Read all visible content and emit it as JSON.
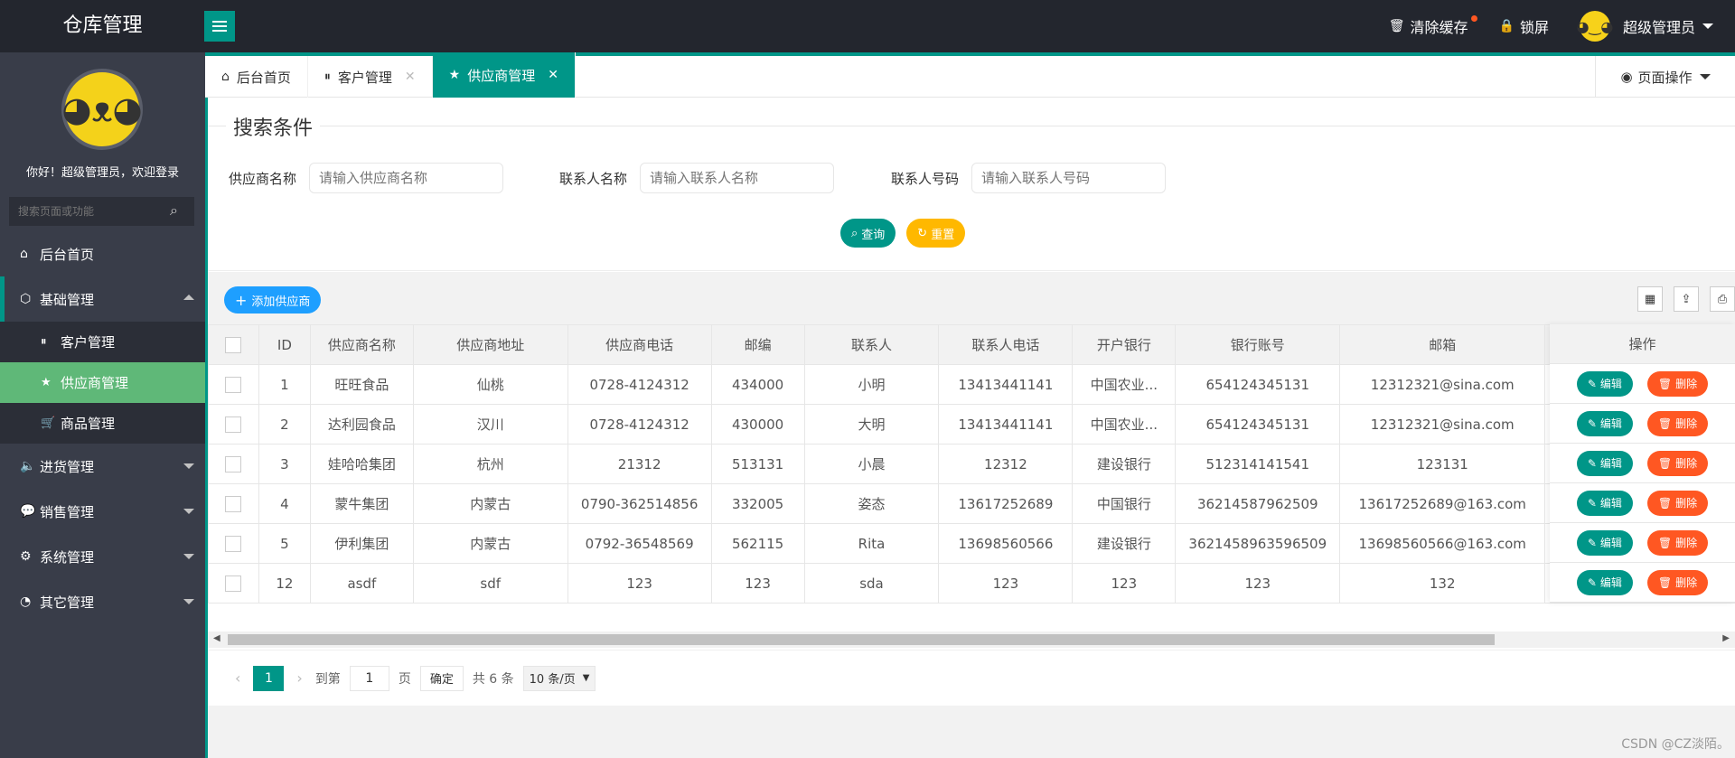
{
  "app": {
    "title": "仓库管理"
  },
  "header": {
    "clear_cache": "清除缓存",
    "lock": "锁屏",
    "user": "超级管理员"
  },
  "sidebar": {
    "welcome": "你好！超级管理员，欢迎登录",
    "search_placeholder": "搜索页面或功能",
    "items": [
      {
        "label": "后台首页",
        "icon": "home-icon"
      },
      {
        "label": "基础管理",
        "icon": "cube-icon"
      },
      {
        "label": "进货管理",
        "icon": "speaker-icon"
      },
      {
        "label": "销售管理",
        "icon": "chat-icon"
      },
      {
        "label": "系统管理",
        "icon": "gear-icon"
      },
      {
        "label": "其它管理",
        "icon": "circle-icon"
      }
    ],
    "sub_items": [
      {
        "label": "客户管理",
        "icon": "pause-circle-icon"
      },
      {
        "label": "供应商管理",
        "icon": "star-icon"
      },
      {
        "label": "商品管理",
        "icon": "cart-icon"
      }
    ]
  },
  "tabs": [
    {
      "label": "后台首页"
    },
    {
      "label": "客户管理"
    },
    {
      "label": "供应商管理"
    }
  ],
  "page_ops": "页面操作",
  "search": {
    "legend": "搜索条件",
    "fields": [
      {
        "label": "供应商名称",
        "placeholder": "请输入供应商名称"
      },
      {
        "label": "联系人名称",
        "placeholder": "请输入联系人名称"
      },
      {
        "label": "联系人号码",
        "placeholder": "请输入联系人号码"
      }
    ],
    "query": "查询",
    "reset": "重置"
  },
  "toolbar": {
    "add": "添加供应商"
  },
  "table": {
    "headers": [
      "ID",
      "供应商名称",
      "供应商地址",
      "供应商电话",
      "邮编",
      "联系人",
      "联系人电话",
      "开户银行",
      "银行账号",
      "邮箱"
    ],
    "op_header": "操作",
    "edit": "编辑",
    "delete": "删除",
    "rows": [
      [
        "1",
        "旺旺食品",
        "仙桃",
        "0728-4124312",
        "434000",
        "小明",
        "13413441141",
        "中国农业...",
        "654124345131",
        "12312321@sina.com"
      ],
      [
        "2",
        "达利园食品",
        "汉川",
        "0728-4124312",
        "430000",
        "大明",
        "13413441141",
        "中国农业...",
        "654124345131",
        "12312321@sina.com"
      ],
      [
        "3",
        "娃哈哈集团",
        "杭州",
        "21312",
        "513131",
        "小晨",
        "12312",
        "建设银行",
        "512314141541",
        "123131"
      ],
      [
        "4",
        "蒙牛集团",
        "内蒙古",
        "0790-362514856",
        "332005",
        "姿态",
        "13617252689",
        "中国银行",
        "36214587962509",
        "13617252689@163.com"
      ],
      [
        "5",
        "伊利集团",
        "内蒙古",
        "0792-36548569",
        "562115",
        "Rita",
        "13698560566",
        "建设银行",
        "3621458963596509",
        "13698560566@163.com"
      ],
      [
        "12",
        "asdf",
        "sdf",
        "123",
        "123",
        "sda",
        "123",
        "123",
        "123",
        "132"
      ]
    ]
  },
  "pager": {
    "current": "1",
    "goto": "到第",
    "page_input": "1",
    "page_unit": "页",
    "confirm": "确定",
    "total": "共 6 条",
    "per_page": "10 条/页"
  },
  "watermark": "CSDN @CZ淡陌。"
}
